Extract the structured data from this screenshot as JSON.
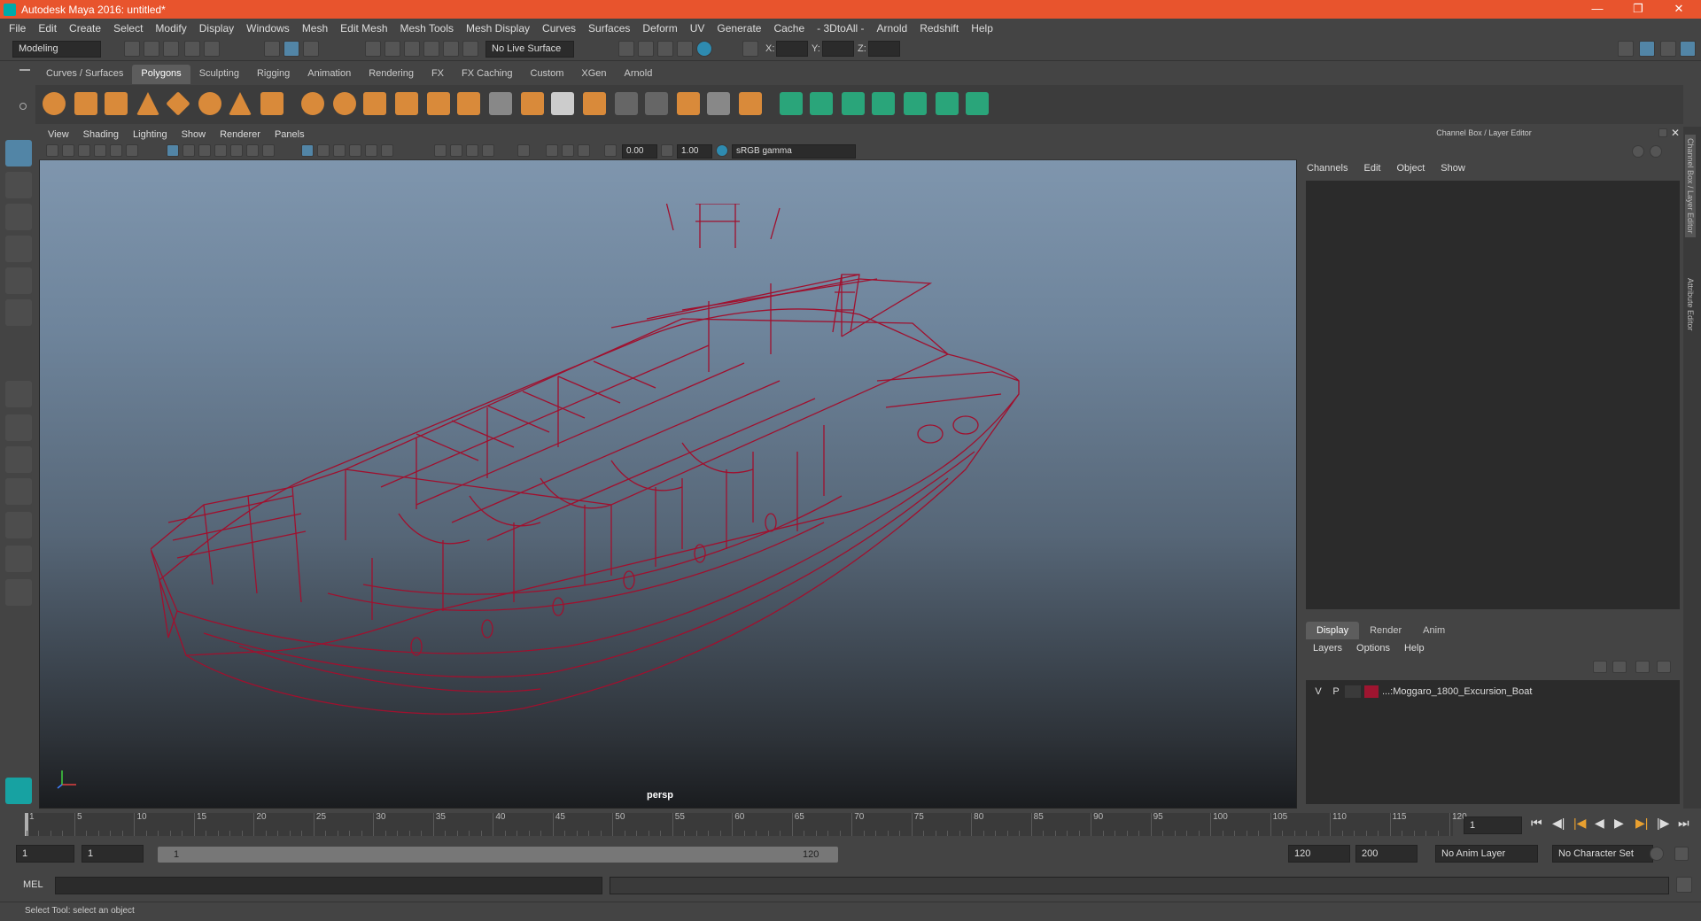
{
  "window": {
    "title": "Autodesk Maya 2016: untitled*"
  },
  "menubar": [
    "File",
    "Edit",
    "Create",
    "Select",
    "Modify",
    "Display",
    "Windows",
    "Mesh",
    "Edit Mesh",
    "Mesh Tools",
    "Mesh Display",
    "Curves",
    "Surfaces",
    "Deform",
    "UV",
    "Generate",
    "Cache",
    "- 3DtoAll -",
    "Arnold",
    "Redshift",
    "Help"
  ],
  "statusline": {
    "mode": "Modeling",
    "live_surface": "No Live Surface",
    "x_label": "X:",
    "y_label": "Y:",
    "z_label": "Z:"
  },
  "shelf_tabs": [
    "Curves / Surfaces",
    "Polygons",
    "Sculpting",
    "Rigging",
    "Animation",
    "Rendering",
    "FX",
    "FX Caching",
    "Custom",
    "XGen",
    "Arnold"
  ],
  "shelf_active": "Polygons",
  "viewport": {
    "menu": [
      "View",
      "Shading",
      "Lighting",
      "Show",
      "Renderer",
      "Panels"
    ],
    "exposure": "0.00",
    "gamma": "1.00",
    "color_space": "sRGB gamma",
    "camera_label": "persp",
    "wire_color": "#a0102e"
  },
  "channel_box": {
    "title": "Channel Box / Layer Editor",
    "menu": [
      "Channels",
      "Edit",
      "Object",
      "Show"
    ]
  },
  "layer_editor": {
    "tabs": [
      "Display",
      "Render",
      "Anim"
    ],
    "active_tab": "Display",
    "menu": [
      "Layers",
      "Options",
      "Help"
    ],
    "layers": [
      {
        "v": "V",
        "p": "P",
        "name": "...:Moggaro_1800_Excursion_Boat",
        "color": "#9e1530"
      }
    ]
  },
  "side_tabs": [
    "Channel Box / Layer Editor",
    "Attribute Editor"
  ],
  "timeline": {
    "ticks": [
      "1",
      "5",
      "10",
      "15",
      "20",
      "25",
      "30",
      "35",
      "40",
      "45",
      "50",
      "55",
      "60",
      "65",
      "70",
      "75",
      "80",
      "85",
      "90",
      "95",
      "100",
      "105",
      "110",
      "115",
      "120"
    ],
    "current_frame": "1"
  },
  "range": {
    "start": "1",
    "playback_start": "1",
    "slider_start": "1",
    "slider_end": "120",
    "playback_end": "120",
    "end": "200",
    "anim_layer": "No Anim Layer",
    "character_set": "No Character Set"
  },
  "cmdline": {
    "label": "MEL"
  },
  "helpline": {
    "text": "Select Tool: select an object"
  }
}
